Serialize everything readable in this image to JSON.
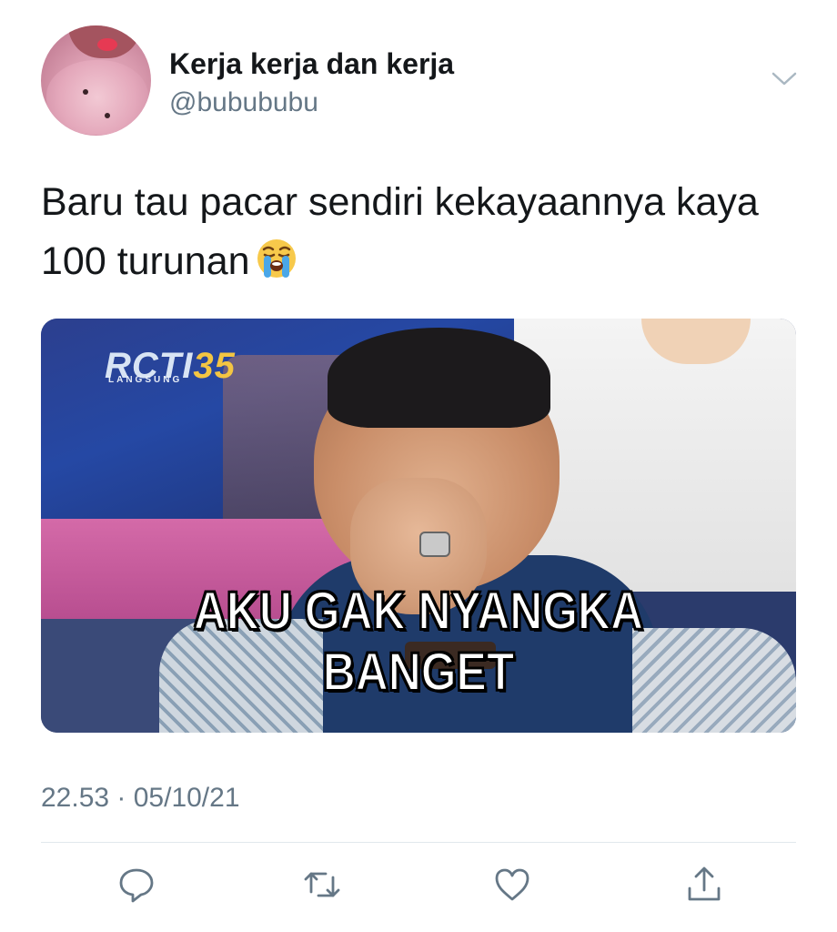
{
  "user": {
    "display_name": "Kerja kerja dan kerja",
    "handle": "@bubububu",
    "avatar_icon": "avatar-image"
  },
  "header": {
    "menu_icon": "chevron-down-icon"
  },
  "tweet": {
    "text": "Baru tau pacar sendiri kekayaannya kaya 100 turunan",
    "emoji": "loudly-crying-face-emoji"
  },
  "media": {
    "logo_text": "RCTI",
    "logo_number": "35",
    "live_label": "LANGSUNG",
    "caption": "AKU GAK NYANGKA BANGET"
  },
  "meta": {
    "timestamp": "22.53 · 05/10/21"
  },
  "actions": [
    {
      "name": "reply",
      "icon": "reply-icon"
    },
    {
      "name": "retweet",
      "icon": "retweet-icon"
    },
    {
      "name": "like",
      "icon": "heart-icon"
    },
    {
      "name": "share",
      "icon": "share-icon"
    }
  ],
  "colors": {
    "text_primary": "#14171a",
    "text_secondary": "#657786",
    "divider": "#e1e8ed",
    "icon": "#657786"
  }
}
